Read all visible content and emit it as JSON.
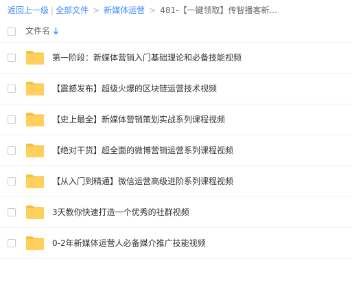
{
  "breadcrumb": {
    "back": "返回上一级",
    "all_files": "全部文件",
    "folder": "新媒体运营",
    "current": "481-【一键领取】传智播客新..."
  },
  "header": {
    "column_name": "文件名",
    "sort_icon": "arrow-down-icon"
  },
  "files": [
    {
      "name": "第一阶段：新媒体营销入门基础理论和必备技能视频",
      "icon": "folder-icon"
    },
    {
      "name": "【震撼发布】超级火爆的区块链运营技术视频",
      "icon": "folder-icon"
    },
    {
      "name": "【史上最全】新媒体营销策划实战系列课程视频",
      "icon": "folder-icon"
    },
    {
      "name": "【绝对干货】超全面的微博营销运营系列课程视频",
      "icon": "folder-icon"
    },
    {
      "name": "【从入门到精通】微信运营高级进阶系列课程视频",
      "icon": "folder-icon"
    },
    {
      "name": "3天教你快速打造一个优秀的社群视频",
      "icon": "folder-icon"
    },
    {
      "name": "0-2年新媒体运营人必备媒介推广技能视频",
      "icon": "folder-icon"
    }
  ],
  "colors": {
    "link": "#3b8cff",
    "folder": "#ffd15c",
    "folder_tab": "#f5bf3f"
  }
}
